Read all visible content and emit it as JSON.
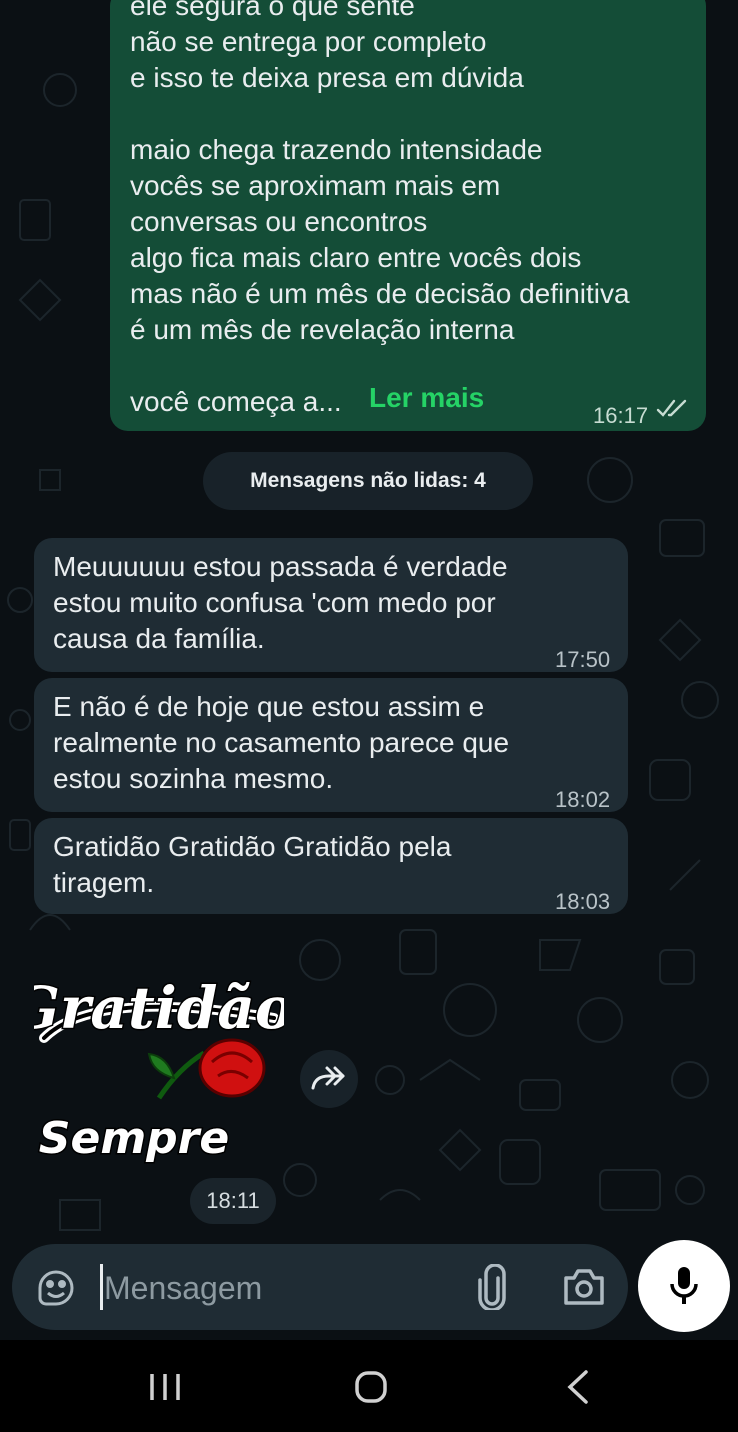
{
  "conversation": {
    "outgoing_message": {
      "text": "ele segura o que sente\nnão se entrega por completo\ne isso te deixa presa em dúvida\n\nmaio chega trazendo intensidade\nvocês se aproximam mais em\nconversas ou encontros\nalgo fica mais claro entre vocês dois\nmas não é um mês de decisão definitiva\né um mês de revelação interna\n\nvocê começa a...",
      "read_more_label": "Ler mais",
      "time": "16:17",
      "status_icon": "double-check-icon"
    },
    "unread_banner": "Mensagens não lidas: 4",
    "incoming_messages": [
      {
        "text": "Meuuuuuu estou passada é  verdade estou muito confusa 'com medo por causa da família.",
        "time": "17:50"
      },
      {
        "text": "E não  é  de hoje  que estou assim e realmente  no casamento  parece que estou sozinha  mesmo.",
        "time": "18:02"
      },
      {
        "text": "Gratidão Gratidão Gratidão  pela tiragem.",
        "time": "18:03"
      }
    ],
    "sticker": {
      "text_line1": "Gratidão",
      "text_line2": "Sempre",
      "time": "18:11",
      "forward_icon": "forward-icon"
    }
  },
  "composer": {
    "placeholder": "Mensagem",
    "emoji_icon": "sticker-emoji-icon",
    "attach_icon": "paperclip-icon",
    "camera_icon": "camera-icon",
    "mic_icon": "microphone-icon"
  },
  "navigation_bar": {
    "recents_icon": "recent-apps-icon",
    "home_icon": "home-icon",
    "back_icon": "back-icon"
  },
  "colors": {
    "background": "#0b1014",
    "outgoing_bubble": "#144d37",
    "incoming_bubble": "#1f2c34",
    "accent": "#25d366"
  }
}
